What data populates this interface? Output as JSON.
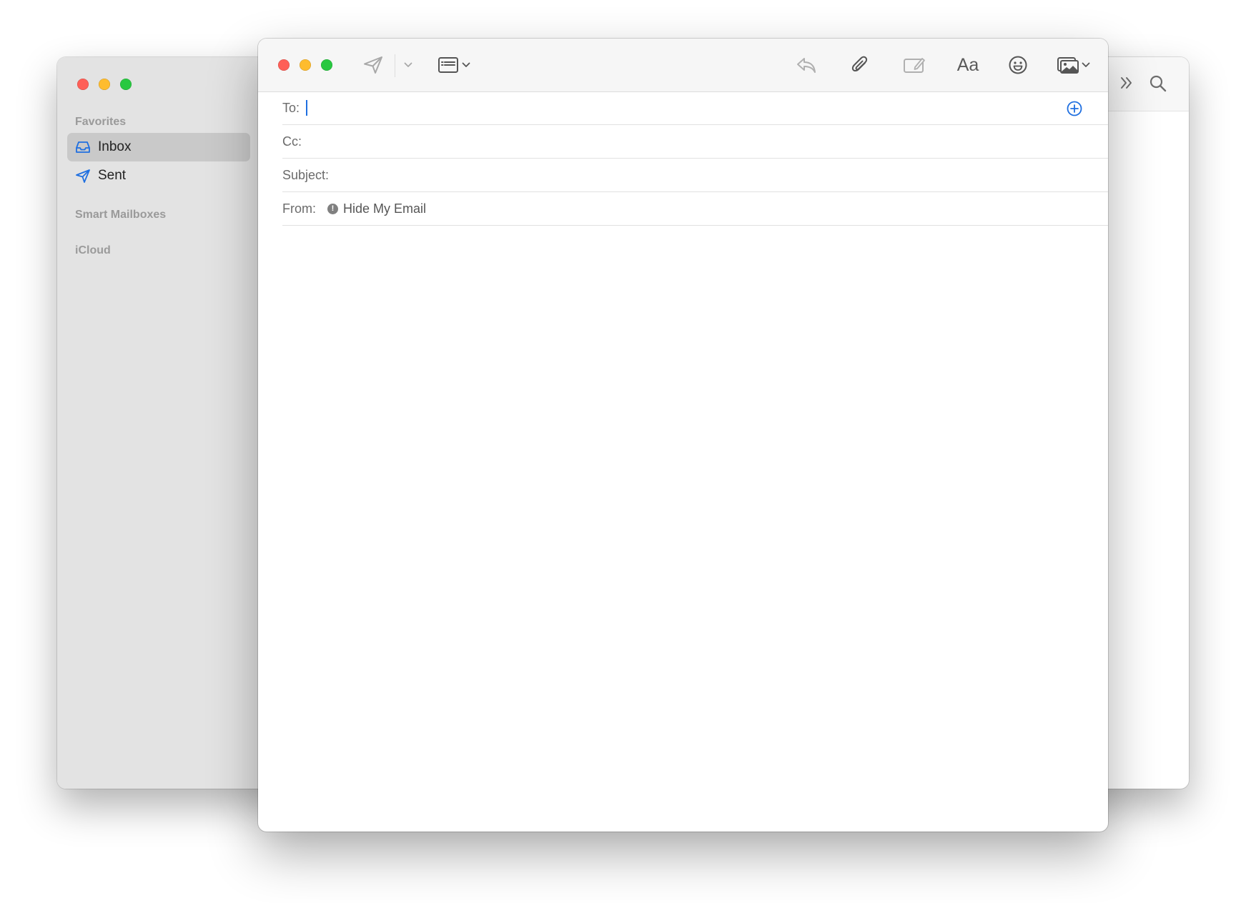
{
  "sidebar": {
    "favorites_heading": "Favorites",
    "items": [
      {
        "label": "Inbox",
        "icon": "tray-icon",
        "selected": true
      },
      {
        "label": "Sent",
        "icon": "paper-plane-icon",
        "selected": false
      }
    ],
    "smart_mailboxes_heading": "Smart Mailboxes",
    "icloud_heading": "iCloud"
  },
  "background_toolbar": {
    "icons": [
      "chevron-double-right-icon",
      "search-icon"
    ]
  },
  "compose": {
    "toolbar": {
      "icons": [
        "send-icon",
        "send-options-chevron-icon",
        "header-fields-icon",
        "reply-icon",
        "paperclip-icon",
        "markup-icon",
        "format-icon",
        "emoji-icon",
        "photo-browser-icon"
      ],
      "format_label": "Aa"
    },
    "fields": {
      "to_label": "To:",
      "to_value": "",
      "cc_label": "Cc:",
      "cc_value": "",
      "subject_label": "Subject:",
      "subject_value": "",
      "from_label": "From:",
      "from_value": "Hide My Email",
      "from_badge": "!"
    },
    "body": ""
  },
  "colors": {
    "accent": "#1f6fe0",
    "close": "#fe5f57",
    "minimize": "#febc2e",
    "zoom": "#28c840",
    "sidebar_bg": "#e3e3e3",
    "selection": "#c9c9c9"
  }
}
